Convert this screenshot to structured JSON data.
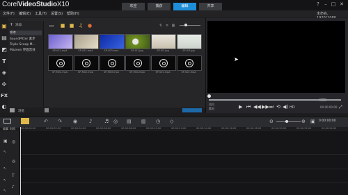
{
  "app": {
    "logo_brand": "Corel",
    "logo_product": "VideoStudio",
    "logo_version": "X10",
    "steps": [
      "欢迎",
      "捕获",
      "编辑",
      "共享"
    ],
    "active_step": 2,
    "window_buttons": [
      "?",
      "–",
      "□",
      "✕"
    ]
  },
  "menu": {
    "items": [
      "文件(F)",
      "编辑(E)",
      "工具(T)",
      "设置(S)",
      "帮助(H)"
    ],
    "project_info": "未命名, 1920*1080"
  },
  "sidebar": {
    "icons": [
      "media-icon",
      "instant-project-icon",
      "transition-icon",
      "title-icon",
      "graphic-icon",
      "filter-icon",
      "fx-icon",
      "path-icon"
    ]
  },
  "library": {
    "add_label": "添加",
    "folders": [
      "样本",
      "SoundPitter 素步",
      "Triple Scoop M...",
      "Mazeon 界面音效"
    ],
    "browse_label": "浏览",
    "thumbs_row1": [
      {
        "label": "SP-V01.mp4",
        "color": "#8b7fd6"
      },
      {
        "label": "SP-V02.mp4",
        "color": "#cfc7b3"
      },
      {
        "label": "SP-V03.mov",
        "color": "#1e3fbf"
      },
      {
        "label": "SP-I01.jpg",
        "color": "#7a9a2a"
      },
      {
        "label": "SP-I02.jpg",
        "color": "#d8d4ca"
      },
      {
        "label": "SP-I03.jpg",
        "color": "#dde1dc"
      }
    ],
    "thumbs_row2": [
      {
        "label": "SP-M01.mpa"
      },
      {
        "label": "SP-M02.mpa"
      },
      {
        "label": "SP-M03.mpa"
      },
      {
        "label": "SP-M04.mpa"
      },
      {
        "label": "SP-S01.mpa"
      },
      {
        "label": "SP-S02.mpa"
      }
    ]
  },
  "player": {
    "mode_project": "项目",
    "mode_clip": "素材",
    "timecode": "00:00:00:00",
    "hd_label": "HD"
  },
  "timeline": {
    "view_labels": [
      "故事",
      "时间"
    ],
    "timecode": "0:00:00:00",
    "ruler_ticks": [
      "00:00:00:00",
      "00:00:02:00",
      "00:00:04:00",
      "00:00:06:00",
      "00:00:08:00",
      "00:00:10:00",
      "00:00:12:00",
      "00:00:14:00",
      "00:00:16:00",
      "00:00:18:00",
      "00:00:20:00",
      "00:00:22:00",
      "00:00:24:00"
    ]
  },
  "colors": {
    "accent": "#1e8ed8",
    "background": "#1d1d1f"
  }
}
